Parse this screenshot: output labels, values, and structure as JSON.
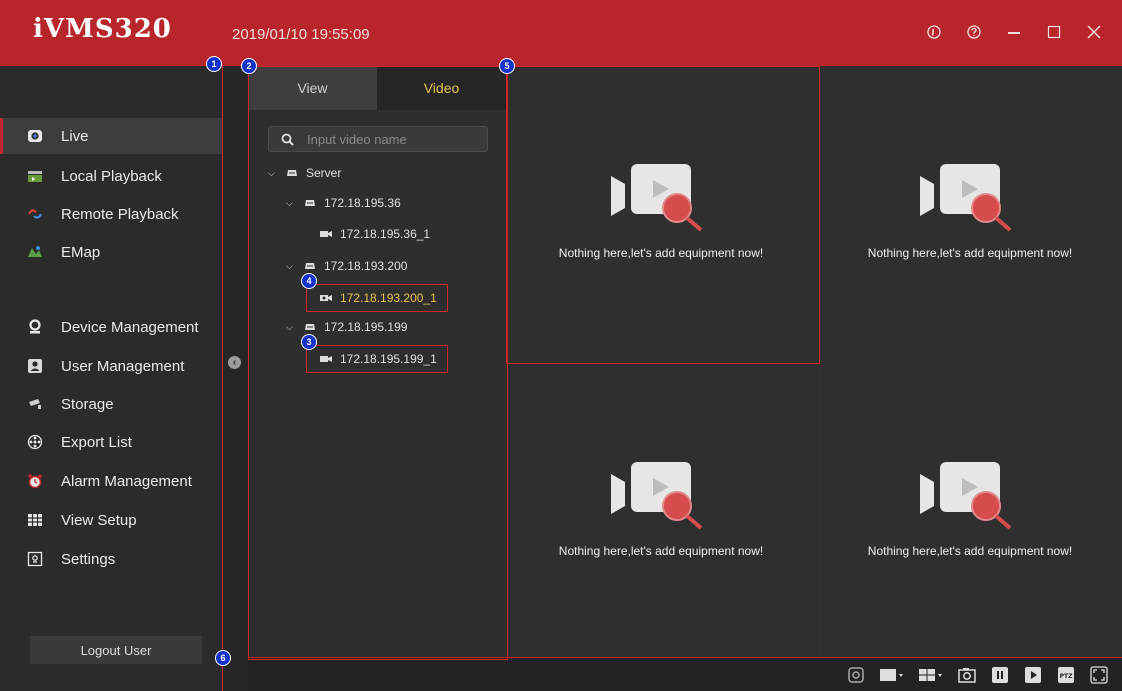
{
  "app": {
    "logo": "iVMS320",
    "datetime": "2019/01/10 19:55:09"
  },
  "window_controls": [
    "info-icon",
    "help-icon",
    "minimize-icon",
    "maximize-icon",
    "close-icon"
  ],
  "sidebar": {
    "items": [
      {
        "label": "Live",
        "icon": "live-icon",
        "active": true
      },
      {
        "label": "Local Playback",
        "icon": "local-playback-icon"
      },
      {
        "label": "Remote Playback",
        "icon": "remote-playback-icon"
      },
      {
        "label": "EMap",
        "icon": "emap-icon"
      },
      {
        "label": "Device Management",
        "icon": "device-management-icon"
      },
      {
        "label": "User Management",
        "icon": "user-management-icon"
      },
      {
        "label": "Storage",
        "icon": "storage-icon"
      },
      {
        "label": "Export List",
        "icon": "export-list-icon"
      },
      {
        "label": "Alarm Management",
        "icon": "alarm-icon"
      },
      {
        "label": "View Setup",
        "icon": "view-setup-icon"
      },
      {
        "label": "Settings",
        "icon": "settings-icon"
      }
    ],
    "logout_label": "Logout User"
  },
  "tree_panel": {
    "tabs": [
      {
        "label": "View"
      },
      {
        "label": "Video",
        "active": true
      }
    ],
    "search_placeholder": "Input video name",
    "tree": [
      {
        "label": "Server",
        "type": "server"
      },
      {
        "label": "172.18.195.36",
        "type": "device"
      },
      {
        "label": "172.18.195.36_1",
        "type": "camera"
      },
      {
        "label": "172.18.193.200",
        "type": "device"
      },
      {
        "label": "172.18.193.200_1",
        "type": "camera",
        "selected": true
      },
      {
        "label": "172.18.195.199",
        "type": "device"
      },
      {
        "label": "172.18.195.199_1",
        "type": "camera"
      }
    ]
  },
  "video_grid": {
    "empty_message": "Nothing here,let's add equipment now!",
    "cells": 4
  },
  "annotations": [
    "1",
    "2",
    "3",
    "4",
    "5",
    "6"
  ],
  "colors": {
    "titlebar": "#b8252a",
    "accent": "#d0252b",
    "selected_text": "#e6c54a",
    "badge": "#1333c9"
  },
  "bottom_toolbar": [
    "fisheye-icon",
    "layout-single-icon",
    "layout-quad-icon",
    "snapshot-icon",
    "pause-icon",
    "play-icon",
    "ptz-icon",
    "fullscreen-icon"
  ]
}
